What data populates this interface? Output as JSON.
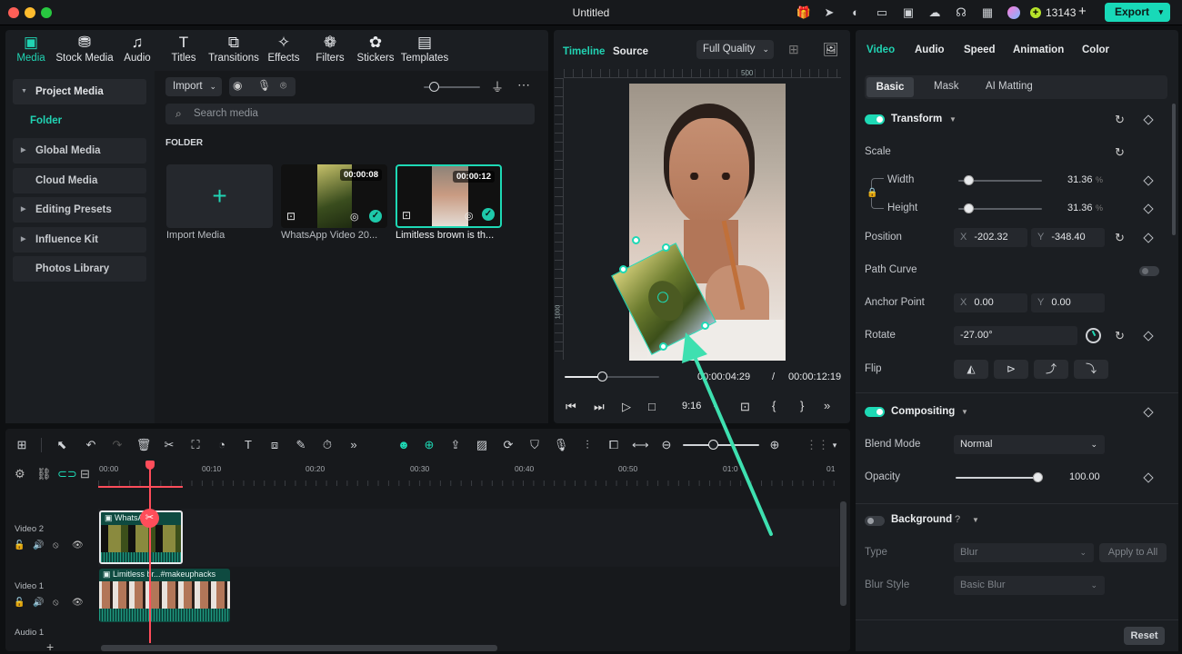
{
  "window": {
    "title": "Untitled",
    "credits": "13143",
    "export_label": "Export"
  },
  "top_tabs": [
    {
      "label": "Media",
      "icon": "media-icon"
    },
    {
      "label": "Stock Media",
      "icon": "stock-media-icon"
    },
    {
      "label": "Audio",
      "icon": "music-icon"
    },
    {
      "label": "Titles",
      "icon": "titles-icon"
    },
    {
      "label": "Transitions",
      "icon": "transitions-icon"
    },
    {
      "label": "Effects",
      "icon": "effects-icon"
    },
    {
      "label": "Filters",
      "icon": "filters-icon"
    },
    {
      "label": "Stickers",
      "icon": "stickers-icon"
    },
    {
      "label": "Templates",
      "icon": "templates-icon"
    }
  ],
  "sidebar": {
    "items": [
      {
        "label": "Project Media"
      },
      {
        "label": "Folder"
      },
      {
        "label": "Global Media"
      },
      {
        "label": "Cloud Media"
      },
      {
        "label": "Editing Presets"
      },
      {
        "label": "Influence Kit"
      },
      {
        "label": "Photos Library"
      }
    ]
  },
  "media": {
    "import_label": "Import",
    "search_placeholder": "Search media",
    "section_title": "FOLDER",
    "items": [
      {
        "caption": "Import Media"
      },
      {
        "caption": "WhatsApp Video 20...",
        "duration": "00:00:08"
      },
      {
        "caption": "Limitless brown is th...",
        "duration": "00:00:12"
      }
    ]
  },
  "preview": {
    "tab_timeline": "Timeline",
    "tab_source": "Source",
    "quality": "Full Quality",
    "ruler_mark": "500",
    "ruler_side": "1000",
    "current_time": "00:00:04:29",
    "separator": "/",
    "total_time": "00:00:12:19",
    "aspect": "9:16",
    "playhead_progress": 0.39
  },
  "properties": {
    "tabs": [
      "Video",
      "Audio",
      "Speed",
      "Animation",
      "Color"
    ],
    "subtabs": [
      "Basic",
      "Mask",
      "AI Matting"
    ],
    "transform_label": "Transform",
    "scale_label": "Scale",
    "width_label": "Width",
    "width_value": "31.36",
    "height_label": "Height",
    "height_value": "31.36",
    "unit": "%",
    "scale_fraction": 0.12,
    "position_label": "Position",
    "pos_x_prefix": "X",
    "pos_x": "-202.32",
    "pos_y_prefix": "Y",
    "pos_y": "-348.40",
    "path_curve_label": "Path Curve",
    "anchor_label": "Anchor Point",
    "anchor_x": "0.00",
    "anchor_y": "0.00",
    "rotate_label": "Rotate",
    "rotate_value": "-27.00°",
    "flip_label": "Flip",
    "compositing_label": "Compositing",
    "blend_label": "Blend Mode",
    "blend_value": "Normal",
    "opacity_label": "Opacity",
    "opacity_value": "100.00",
    "opacity_fraction": 1.0,
    "background_label": "Background",
    "type_label": "Type",
    "type_value": "Blur",
    "apply_all": "Apply to All",
    "blur_style_label": "Blur Style",
    "blur_style_value": "Basic Blur",
    "reset_label": "Reset"
  },
  "timeline": {
    "ruler": [
      "00:00",
      "00:10",
      "00:20",
      "00:30",
      "00:40",
      "00:50",
      "01:0",
      "01"
    ],
    "tracks": [
      {
        "name": "Video 2",
        "clip": "WhatsA...1)"
      },
      {
        "name": "Video 1",
        "clip": "Limitless br...#makeuphacks"
      },
      {
        "name": "Audio 1"
      }
    ]
  },
  "colors": {
    "accent": "#1ed9b5",
    "playhead": "#ff4d5a",
    "export": "#18d9b8"
  }
}
